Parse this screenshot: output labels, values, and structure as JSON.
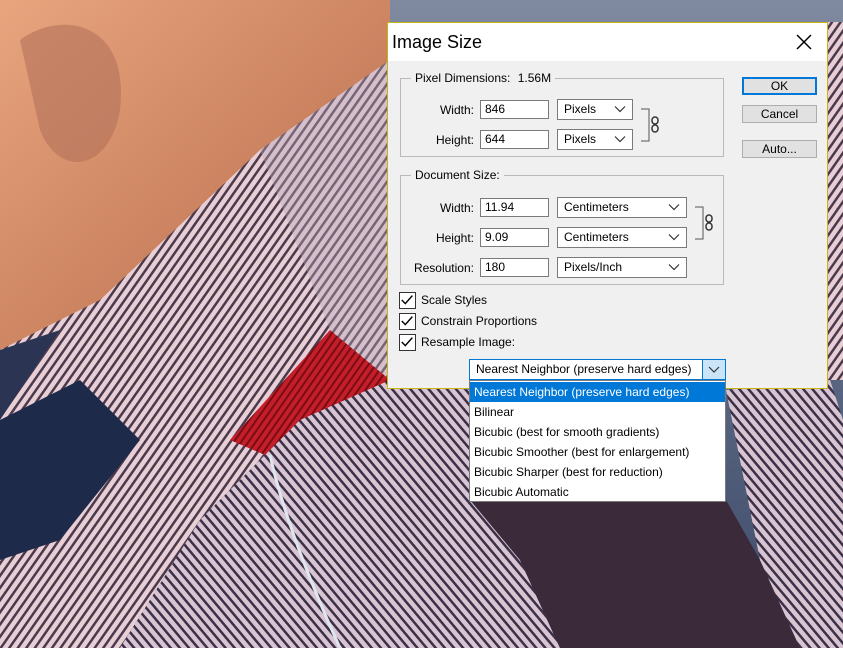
{
  "dialog": {
    "title": "Image Size",
    "pixel_dimensions": {
      "group_label": "Pixel Dimensions:",
      "size_value": "1.56M",
      "width_label": "Width:",
      "width_value": "846",
      "width_unit": "Pixels",
      "height_label": "Height:",
      "height_value": "644",
      "height_unit": "Pixels"
    },
    "document_size": {
      "group_label": "Document Size:",
      "width_label": "Width:",
      "width_value": "11.94",
      "width_unit": "Centimeters",
      "height_label": "Height:",
      "height_value": "9.09",
      "height_unit": "Centimeters",
      "resolution_label": "Resolution:",
      "resolution_value": "180",
      "resolution_unit": "Pixels/Inch"
    },
    "options": {
      "scale_styles": {
        "label": "Scale Styles",
        "checked": true
      },
      "constrain_proportions": {
        "label": "Constrain Proportions",
        "checked": true
      },
      "resample_image": {
        "label": "Resample Image:",
        "checked": true
      }
    },
    "resample_selected": "Nearest Neighbor (preserve hard edges)",
    "buttons": {
      "ok": "OK",
      "cancel": "Cancel",
      "auto": "Auto..."
    }
  },
  "dropdown": {
    "items": [
      "Nearest Neighbor (preserve hard edges)",
      "Bilinear",
      "Bicubic (best for smooth gradients)",
      "Bicubic Smoother (best for enlargement)",
      "Bicubic Sharper (best for reduction)",
      "Bicubic Automatic"
    ],
    "selected_index": 0
  },
  "colors": {
    "accent": "#0078d7",
    "dialog_border": "#c8b414"
  }
}
